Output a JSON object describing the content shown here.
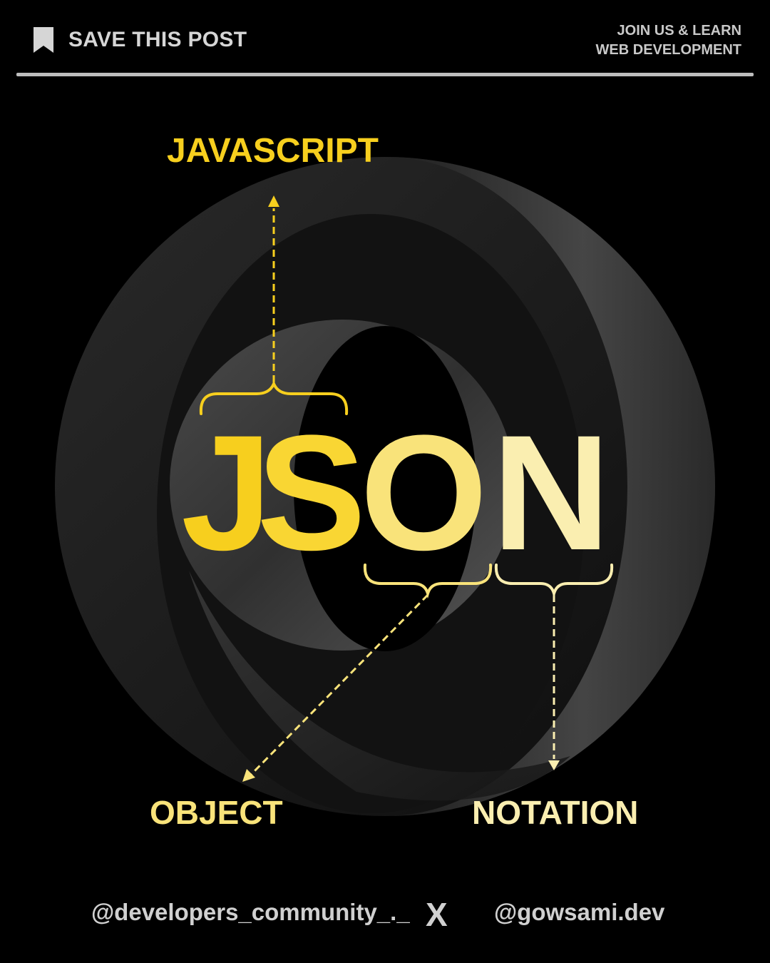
{
  "header": {
    "save_label": "SAVE THIS POST",
    "join_line1": "JOIN US & LEARN",
    "join_line2": "WEB DEVELOPMENT"
  },
  "title": {
    "letters": [
      "J",
      "S",
      "O",
      "N"
    ]
  },
  "labels": {
    "javascript": "JAVASCRIPT",
    "object": "OBJECT",
    "notation": "NOTATION"
  },
  "footer": {
    "handle_left": "@developers_community_._",
    "separator": "X",
    "handle_right": "@gowsami.dev"
  },
  "colors": {
    "background": "#000000",
    "yellow_primary": "#f7cf1e",
    "yellow_mid": "#f9e37a",
    "yellow_light": "#faeeb0",
    "ring_gray": "#3a3a3a",
    "text_gray": "#d0d0d0"
  },
  "icons": {
    "bookmark": "bookmark-icon"
  }
}
